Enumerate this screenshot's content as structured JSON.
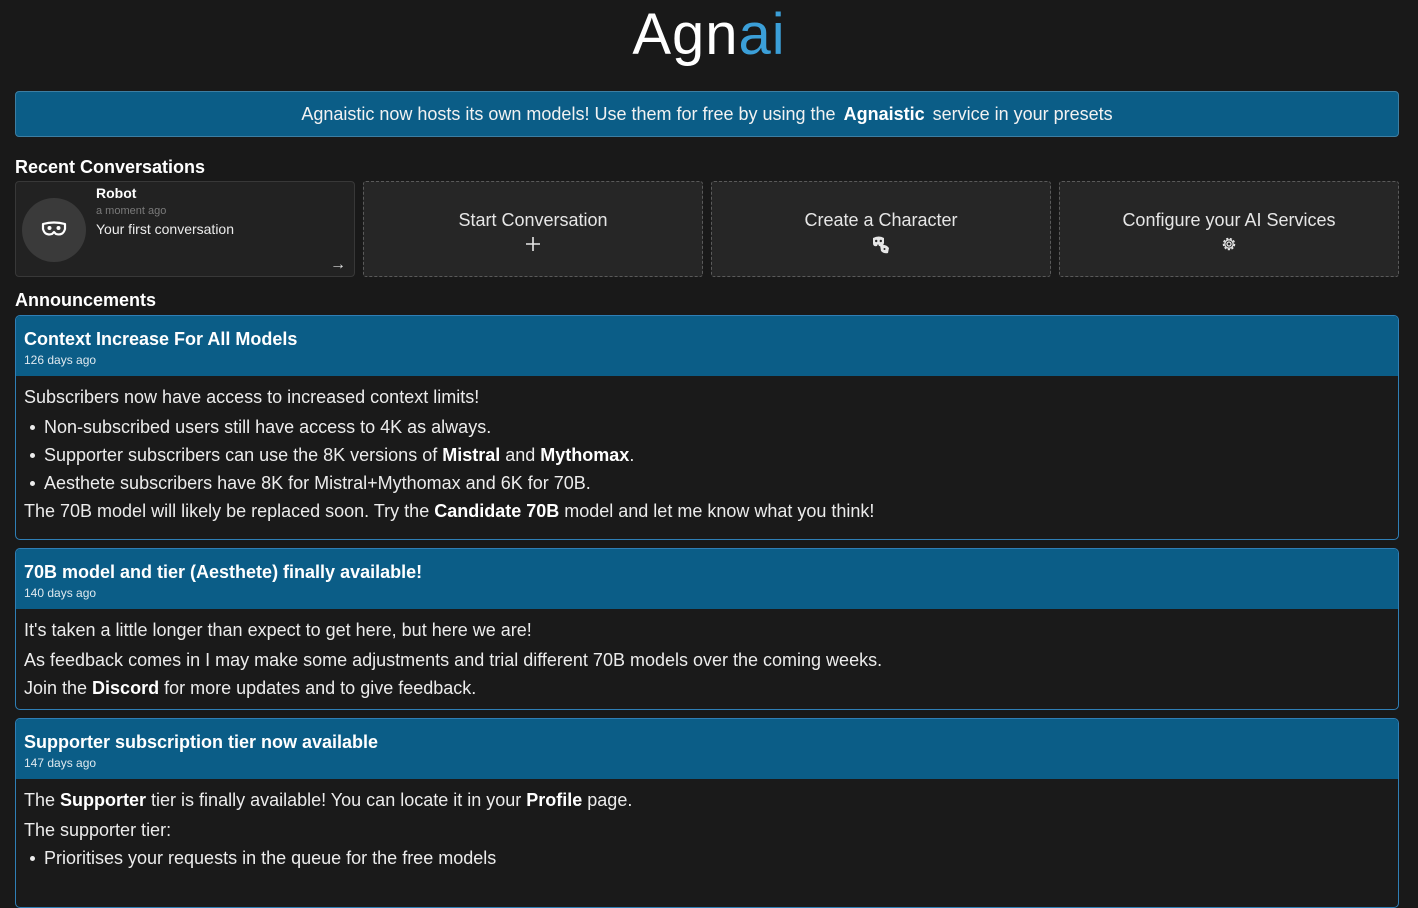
{
  "logo": {
    "main": "Agn",
    "accent": "ai"
  },
  "banner": {
    "before": "Agnaistic now hosts its own models! Use them for free by using the",
    "bold": "Agnaistic",
    "after": "service in your presets"
  },
  "recent": {
    "title": "Recent Conversations",
    "conversation": {
      "name": "Robot",
      "time": "a moment ago",
      "preview": "Your first conversation",
      "arrow": "→"
    },
    "actions": [
      {
        "label": "Start Conversation",
        "icon": "plus-icon"
      },
      {
        "label": "Create a Character",
        "icon": "character-icon"
      },
      {
        "label": "Configure your AI Services",
        "icon": "gear-icon"
      }
    ]
  },
  "announcements": {
    "title": "Announcements",
    "items": [
      {
        "title": "Context Increase For All Models",
        "time": "126 days ago",
        "lines": [
          {
            "text": "Subscribers now have access to increased context limits!"
          },
          {
            "bullet": true,
            "text": "Non-subscribed users still have access to 4K as always."
          },
          {
            "bullet": true,
            "a": "Supporter subscribers can use the 8K versions of ",
            "b1": "Mistral",
            "c": " and ",
            "b2": "Mythomax",
            "d": "."
          },
          {
            "bullet": true,
            "text": "Aesthete subscribers have 8K for Mistral+Mythomax and 6K for 70B."
          },
          {
            "a": "The 70B model will likely be replaced soon. Try the ",
            "b1": "Candidate 70B",
            "c": " model and let me know what you think!"
          }
        ]
      },
      {
        "title": "70B model and tier (Aesthete) finally available!",
        "time": "140 days ago",
        "lines": [
          {
            "text": "It's taken a little longer than expect to get here, but here we are!"
          },
          {
            "text": "As feedback comes in I may make some adjustments and trial different 70B models over the coming weeks."
          },
          {
            "a": "Join the ",
            "b1": "Discord",
            "c": " for more updates and to give feedback."
          }
        ]
      },
      {
        "title": "Supporter subscription tier now available",
        "time": "147 days ago",
        "lines": [
          {
            "a": "The ",
            "b1": "Supporter",
            "c": " tier is finally available! You can locate it in your ",
            "b2": "Profile",
            "d": " page."
          },
          {
            "text": "The supporter tier:"
          },
          {
            "bullet": true,
            "text": "Prioritises your requests in the queue for the free models"
          }
        ]
      }
    ]
  }
}
